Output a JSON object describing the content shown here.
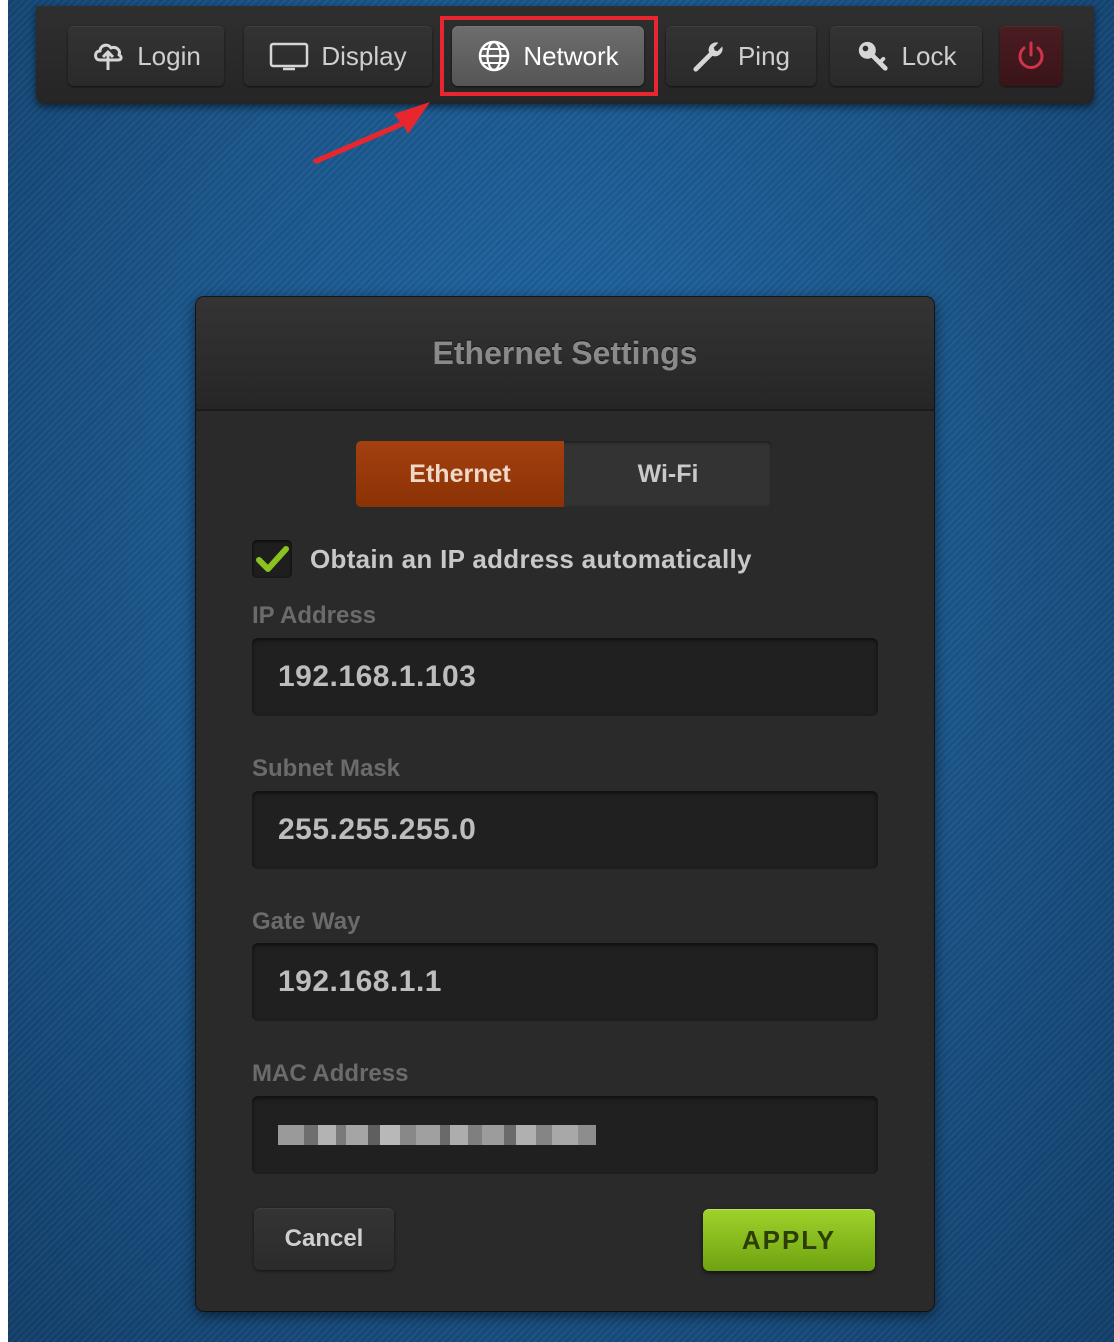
{
  "toolbar": {
    "buttons": [
      {
        "label": "Login",
        "icon": "cloud-upload-icon"
      },
      {
        "label": "Display",
        "icon": "monitor-icon"
      },
      {
        "label": "Network",
        "icon": "globe-icon",
        "active": true
      },
      {
        "label": "Ping",
        "icon": "wrench-icon"
      },
      {
        "label": "Lock",
        "icon": "key-icon"
      },
      {
        "label": "",
        "icon": "power-icon"
      }
    ]
  },
  "annotation": {
    "highlight_color": "#e8262d"
  },
  "dialog": {
    "title": "Ethernet Settings",
    "tabs": [
      {
        "label": "Ethernet",
        "active": true
      },
      {
        "label": "Wi-Fi",
        "active": false
      }
    ],
    "auto_ip": {
      "label": "Obtain an IP address automatically",
      "checked": true
    },
    "fields": {
      "ip": {
        "label": "IP Address",
        "value": "192.168.1.103"
      },
      "subnet": {
        "label": "Subnet Mask",
        "value": "255.255.255.0"
      },
      "gateway": {
        "label": "Gate Way",
        "value": "192.168.1.1"
      },
      "mac": {
        "label": "MAC Address",
        "value": ""
      }
    },
    "cancel_label": "Cancel",
    "apply_label": "APPLY"
  },
  "colors": {
    "background": "#1d5a92",
    "active_tab": "#9a3a0a",
    "apply": "#8cc21f",
    "checkmark": "#8cc21f",
    "power": "#d0344a"
  }
}
